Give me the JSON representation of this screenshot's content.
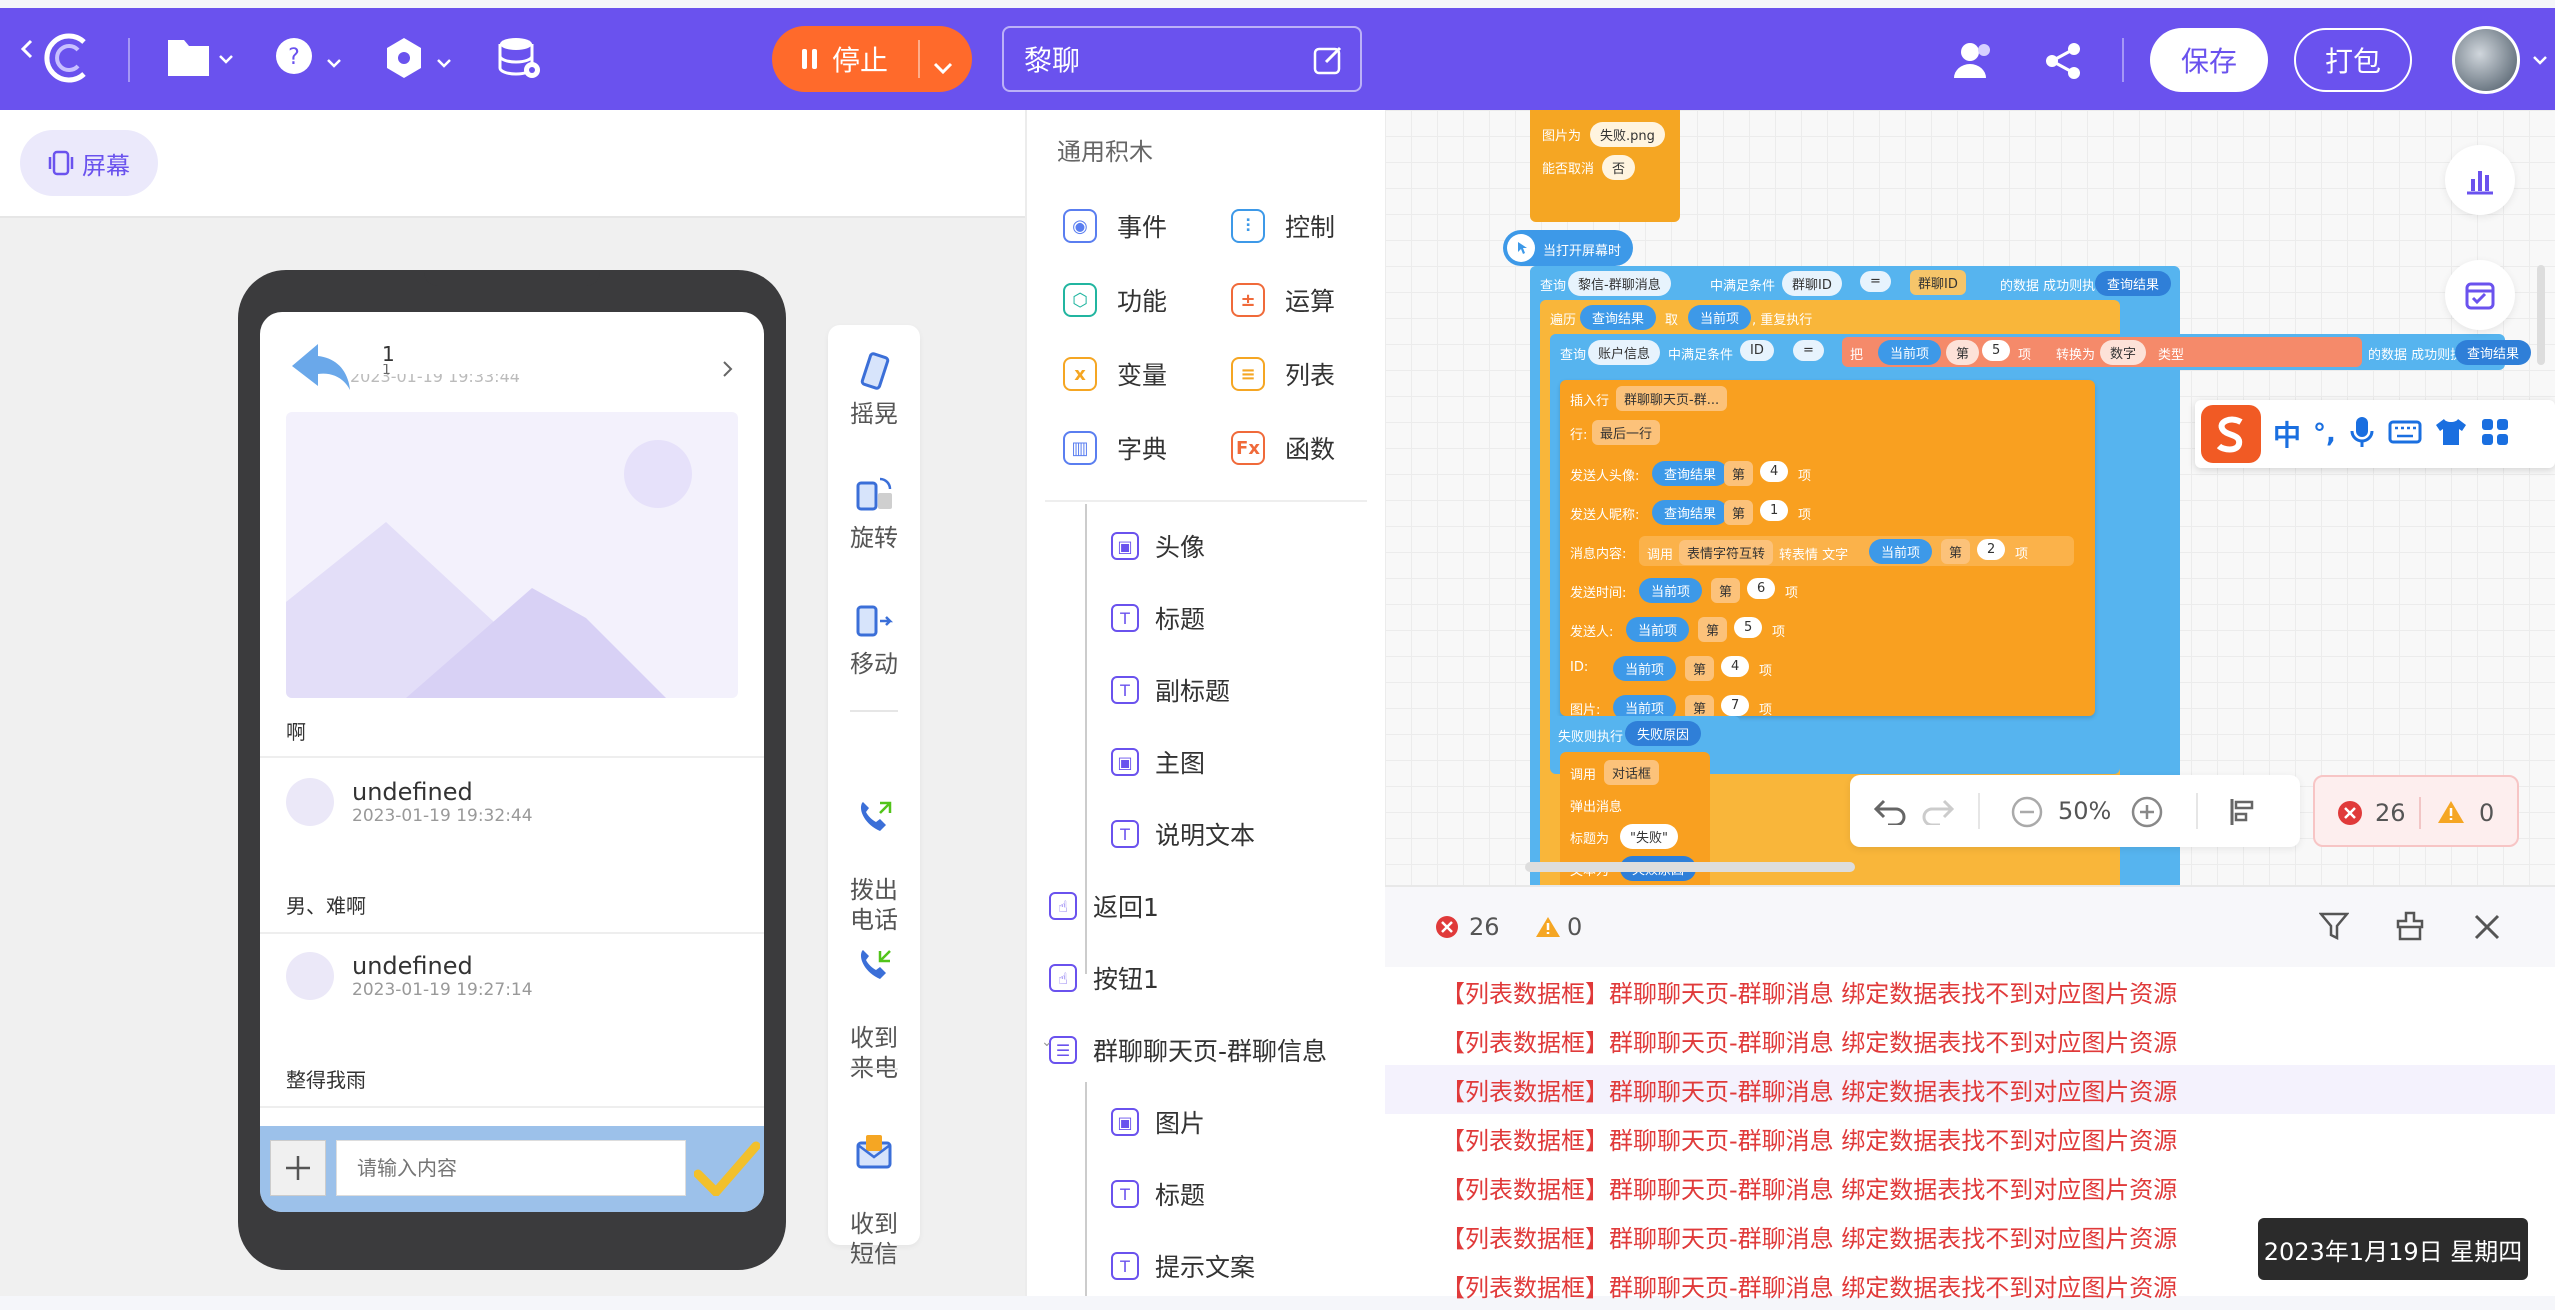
{
  "topbar": {
    "stop_label": "停止",
    "project_name": "黎聊",
    "save_label": "保存",
    "package_label": "打包"
  },
  "left": {
    "screen_tab": "屏幕",
    "sensors": [
      "摇晃",
      "旋转",
      "移动",
      "拨出\n电话",
      "收到\n来电",
      "收到\n短信"
    ]
  },
  "phone": {
    "header_title": "1",
    "header_sub": "1",
    "header_time": "2023-01-19 19:33:44",
    "post_text": "啊",
    "messages": [
      {
        "name": "undefined",
        "time": "2023-01-19 19:32:44",
        "text": "男、难啊"
      },
      {
        "name": "undefined",
        "time": "2023-01-19 19:27:14",
        "text": "整得我雨"
      }
    ],
    "input_placeholder": "请输入内容"
  },
  "palette": {
    "title": "通用积木",
    "categories": [
      {
        "label": "事件",
        "icon": "event-icon",
        "color": "#5a7ef0"
      },
      {
        "label": "控制",
        "icon": "control-icon",
        "color": "#3d99e8"
      },
      {
        "label": "功能",
        "icon": "function-icon",
        "color": "#21b5a0"
      },
      {
        "label": "运算",
        "icon": "math-icon",
        "color": "#f06a3a"
      },
      {
        "label": "变量",
        "icon": "variable-icon",
        "color": "#f5a623"
      },
      {
        "label": "列表",
        "icon": "list-icon",
        "color": "#f5a623"
      },
      {
        "label": "字典",
        "icon": "dict-icon",
        "color": "#5a7ef0"
      },
      {
        "label": "函数",
        "icon": "fx-icon",
        "color": "#f06a3a"
      }
    ],
    "tree": [
      {
        "label": "头像",
        "icon": "image-icon",
        "indent": 2
      },
      {
        "label": "标题",
        "icon": "text-icon",
        "indent": 2
      },
      {
        "label": "副标题",
        "icon": "text-icon",
        "indent": 2
      },
      {
        "label": "主图",
        "icon": "image-icon",
        "indent": 2
      },
      {
        "label": "说明文本",
        "icon": "text-icon",
        "indent": 2
      },
      {
        "label": "返回1",
        "icon": "button-icon",
        "indent": 1
      },
      {
        "label": "按钮1",
        "icon": "button-icon",
        "indent": 1
      },
      {
        "label": "群聊聊天页-群聊信息",
        "icon": "listview-icon",
        "indent": 1
      },
      {
        "label": "图片",
        "icon": "image-icon",
        "indent": 2
      },
      {
        "label": "标题",
        "icon": "text-icon",
        "indent": 2
      },
      {
        "label": "提示文案",
        "icon": "text-icon",
        "indent": 2
      }
    ]
  },
  "workspace": {
    "top_block": {
      "image_label": "图片为",
      "image_value": "失败.png",
      "cancel_label": "能否取消",
      "cancel_value": "否"
    },
    "event_label": "当打开屏幕时",
    "query1": {
      "label": "查询",
      "table": "黎信-群聊消息",
      "cond_label": "中满足条件",
      "field": "群聊ID",
      "op": "=",
      "value": "群聊ID",
      "tail": "的数据 成功则执行",
      "result": "查询结果"
    },
    "foreach": {
      "label": "遍历",
      "list": "查询结果",
      "take": "取",
      "item": "当前项",
      "tail": ", 重复执行"
    },
    "query2": {
      "label": "查询",
      "table": "账户信息",
      "cond_label": "中满足条件",
      "field": "ID",
      "op": "=",
      "conv": "把",
      "item": "当前项",
      "nth": "第",
      "n": "5",
      "unit": "项",
      "to": "转换为",
      "type": "数字",
      "typeunit": "类型",
      "tail": "的数据 成功则执行",
      "result": "查询结果"
    },
    "insert": {
      "label": "插入行",
      "target": "群聊聊天页-群...",
      "row_label": "行:",
      "row_value": "最后一行"
    },
    "fields": [
      {
        "label": "发送人头像:",
        "src": "查询结果",
        "n": "4"
      },
      {
        "label": "发送人昵称:",
        "src": "查询结果",
        "n": "1"
      },
      {
        "label": "消息内容:",
        "src": "当前项",
        "n": "2",
        "call": "调用",
        "fn": "表情字符互转",
        "fn2": "转表情 文字"
      },
      {
        "label": "发送时间:",
        "src": "当前项",
        "n": "6"
      },
      {
        "label": "发送人:",
        "src": "当前项",
        "n": "5"
      },
      {
        "label": "ID:",
        "src": "当前项",
        "n": "4"
      },
      {
        "label": "图片:",
        "src": "当前项",
        "n": "7"
      }
    ],
    "nth": "第",
    "unit": "项",
    "fail": {
      "label": "失败则执行",
      "reason": "失败原因"
    },
    "dialog": {
      "call": "调用",
      "target": "对话框",
      "action": "弹出消息",
      "title_label": "标题为",
      "title_value": "\"失败\"",
      "text_label": "文本为",
      "text_value": "失败原因"
    },
    "zoom": "50%",
    "errors": "26",
    "warnings": "0"
  },
  "errpanel": {
    "errors": "26",
    "warnings": "0",
    "rows": [
      "【列表数据框】群聊聊天页-群聊消息 绑定数据表找不到对应图片资源",
      "【列表数据框】群聊聊天页-群聊消息 绑定数据表找不到对应图片资源",
      "【列表数据框】群聊聊天页-群聊消息 绑定数据表找不到对应图片资源",
      "【列表数据框】群聊聊天页-群聊消息 绑定数据表找不到对应图片资源",
      "【列表数据框】群聊聊天页-群聊消息 绑定数据表找不到对应图片资源",
      "【列表数据框】群聊聊天页-群聊消息 绑定数据表找不到对应图片资源",
      "【列表数据框】群聊聊天页-群聊消息 绑定数据表找不到对应图片资源"
    ]
  },
  "ime": {
    "lang": "中",
    "punct": "°,"
  },
  "datetip": "2023年1月19日 星期四"
}
